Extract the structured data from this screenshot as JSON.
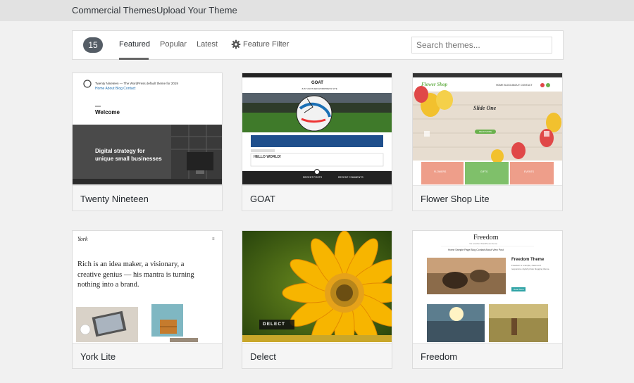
{
  "top_nav": {
    "commercial": "Commercial Themes",
    "upload": "Upload Your Theme"
  },
  "filter": {
    "count": "15",
    "tabs": [
      "Featured",
      "Popular",
      "Latest"
    ],
    "feature_filter": "Feature Filter",
    "search_placeholder": "Search themes..."
  },
  "themes": [
    {
      "name": "Twenty Nineteen",
      "preview": {
        "site_title": "Twenty Nineteen — The WordPress default theme for 2019",
        "menu": "Home  About  Blog  Contact",
        "welcome": "Welcome",
        "hero_line1": "Digital strategy for",
        "hero_line2": "unique small businesses"
      }
    },
    {
      "name": "GOAT",
      "preview": {
        "logo": "GOAT",
        "tagline": "JUST ANOTHER WORDPRESS SITE",
        "post_title": "HELLO WORLD!",
        "widget1": "RECENT POSTS",
        "widget2": "RECENT COMMENTS"
      }
    },
    {
      "name": "Flower Shop Lite",
      "preview": {
        "logo": "Flower Shop",
        "menu": "HOME  BLOG  ABOUT  CONTACT",
        "slide_title": "Slide One",
        "button": "READ MORE",
        "box_labels": [
          "FLOWERS",
          "GIFTS",
          "EVENTS"
        ]
      }
    },
    {
      "name": "York Lite",
      "preview": {
        "logo": "York",
        "menu": "≡",
        "intro": "Rich is an idea maker, a visionary, a creative genius — his mantra is turning nothing into a brand."
      }
    },
    {
      "name": "Delect",
      "preview": {
        "banner": "DELECT"
      }
    },
    {
      "name": "Freedom",
      "preview": {
        "title": "Freedom",
        "tagline": "Yet another WordPress theme",
        "menu": "Home  Sample Page  Blog  Contact  About  View Post",
        "feature_title": "Freedom Theme",
        "feature_text": "Freedom is a simple, clean and responsive stylish photo blogging theme.",
        "button": "Read More"
      }
    }
  ],
  "colors": {
    "badge": "#555d66",
    "goat_blue": "#1f4f8c",
    "flower_green": "#6ab14d",
    "flower_salmon": "#ee9e8a",
    "freedom_teal": "#31a4a6",
    "delect_yellow": "#c9a72a"
  }
}
